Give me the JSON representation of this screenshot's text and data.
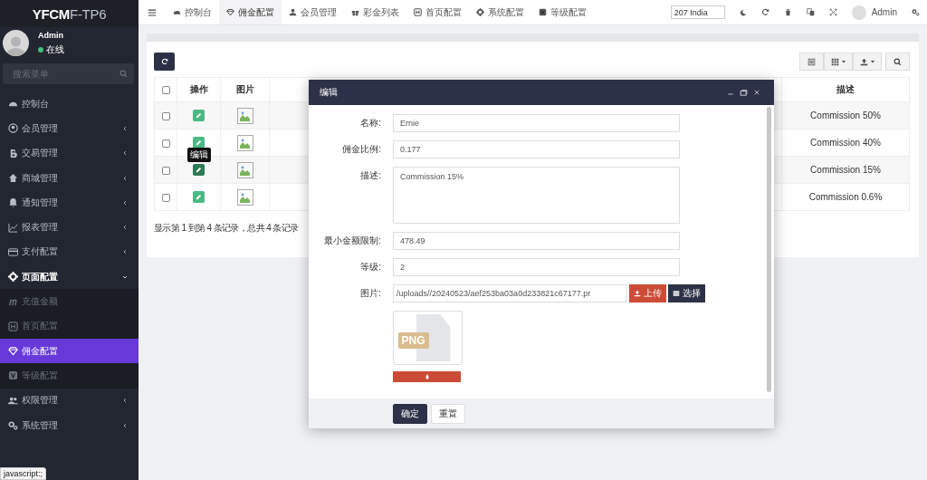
{
  "sidebar": {
    "logo_bold": "YFCM",
    "logo_light": "F-TP6",
    "user": {
      "name": "Admin",
      "status": "在线",
      "online": true
    },
    "search": {
      "placeholder": "搜索菜单"
    },
    "items": [
      {
        "label": "控制台",
        "kind": "link",
        "selected": false
      },
      {
        "label": "会员管理",
        "kind": "group",
        "expanded": false
      },
      {
        "label": "交易管理",
        "kind": "group",
        "expanded": false
      },
      {
        "label": "商城管理",
        "kind": "group",
        "expanded": false
      },
      {
        "label": "通知管理",
        "kind": "group",
        "expanded": false
      },
      {
        "label": "报表管理",
        "kind": "group",
        "expanded": false
      },
      {
        "label": "支付配置",
        "kind": "group",
        "expanded": false
      },
      {
        "label": "页面配置",
        "kind": "group",
        "expanded": true,
        "children": [
          {
            "label": "充值金额",
            "selected": false
          },
          {
            "label": "首页配置",
            "selected": false
          },
          {
            "label": "佣金配置",
            "selected": true
          },
          {
            "label": "等级配置",
            "selected": false
          }
        ]
      },
      {
        "label": "权限管理",
        "kind": "group",
        "expanded": false
      },
      {
        "label": "系统管理",
        "kind": "group",
        "expanded": false
      }
    ]
  },
  "topbar": {
    "tabs": [
      {
        "label": "控制台",
        "selected": false
      },
      {
        "label": "佣金配置",
        "selected": true
      },
      {
        "label": "会员管理",
        "selected": false
      },
      {
        "label": "彩金列表",
        "selected": false
      },
      {
        "label": "首页配置",
        "selected": false
      },
      {
        "label": "系统配置",
        "selected": false
      },
      {
        "label": "等级配置",
        "selected": false
      }
    ],
    "language_field": {
      "value": "207 India"
    },
    "user": "Admin"
  },
  "table": {
    "columns": [
      "操作",
      "图片",
      "描述"
    ],
    "header_checked": false,
    "rows": [
      {
        "checked": false,
        "hovered": false,
        "description": "Commission 50%"
      },
      {
        "checked": false,
        "hovered": false,
        "description": "Commission 40%"
      },
      {
        "checked": false,
        "hovered": true,
        "tooltip": "编辑",
        "description": "Commission 15%"
      },
      {
        "checked": false,
        "hovered": false,
        "description": "Commission 0.6%"
      }
    ],
    "summary": "显示第 1 到第 4 条记录，总共 4 条记录"
  },
  "dialog": {
    "title": "编辑",
    "fields": [
      {
        "label": "名称:",
        "kind": "text",
        "value": "Ernie"
      },
      {
        "label": "佣金比例:",
        "kind": "text",
        "value": "0.177"
      },
      {
        "label": "描述:",
        "kind": "textarea",
        "value": "Commission 15%"
      },
      {
        "label": "最小金额限制:",
        "kind": "text",
        "value": "478.49"
      },
      {
        "label": "等级:",
        "kind": "text",
        "value": "2"
      },
      {
        "label": "图片:",
        "kind": "file",
        "value": "/uploads//20240523/aef253ba03a0d233821c67177.pr",
        "upload": "上传",
        "choose": "选择",
        "preview": "PNG"
      }
    ],
    "buttons": [
      {
        "label": "确定",
        "kind": "primary"
      },
      {
        "label": "重置",
        "kind": "default"
      }
    ]
  },
  "status_link": "javascript:;"
}
